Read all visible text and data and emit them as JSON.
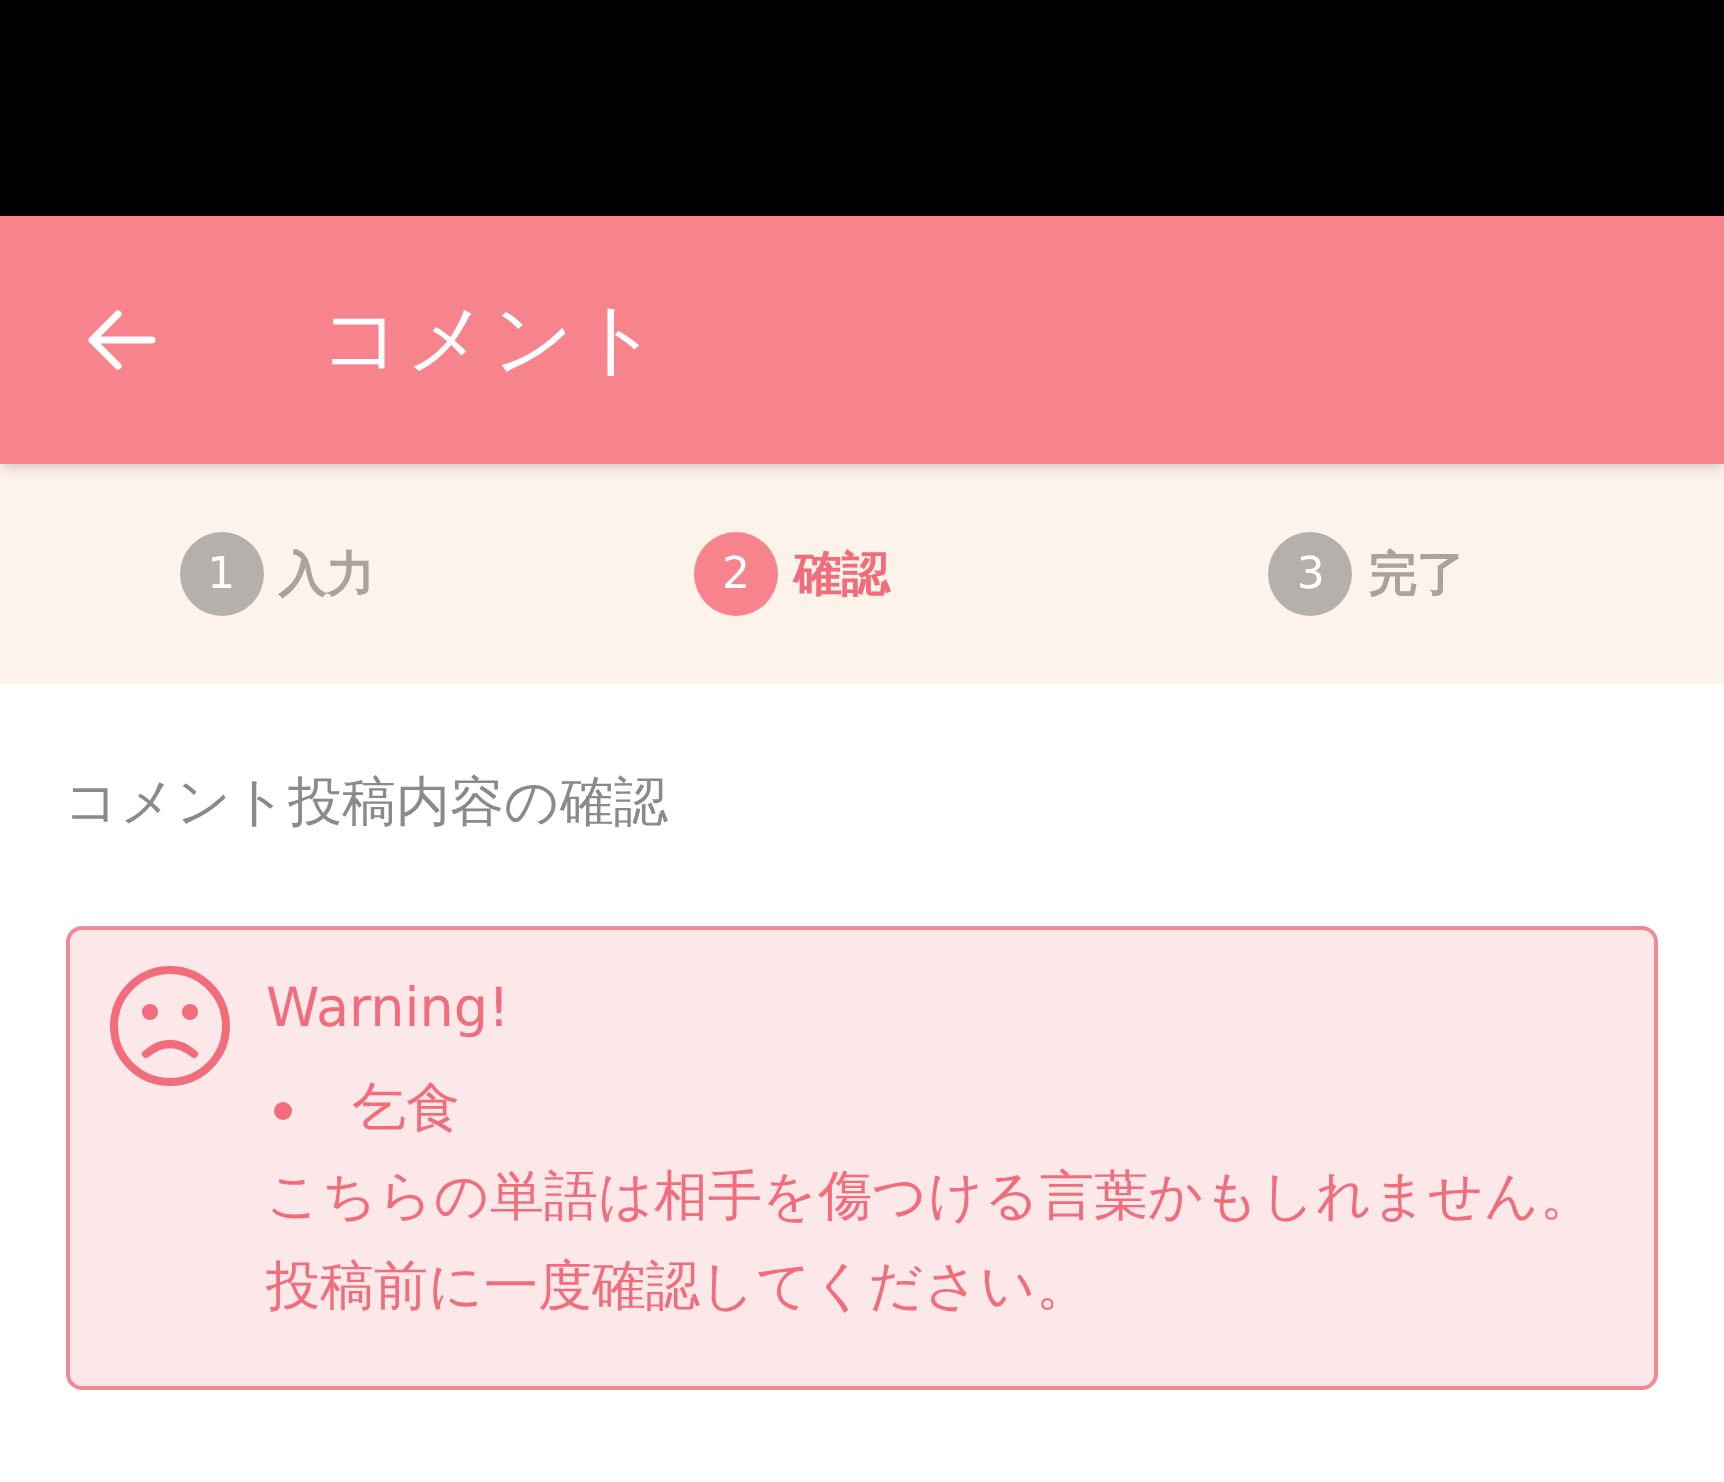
{
  "header": {
    "title": "コメント"
  },
  "steps": [
    {
      "number": "1",
      "label": "入力",
      "selected": false
    },
    {
      "number": "2",
      "label": "確認",
      "selected": true
    },
    {
      "number": "3",
      "label": "完了",
      "selected": false
    }
  ],
  "heading": "コメント投稿内容の確認",
  "warning": {
    "title": "Warning!",
    "words": [
      "乞食"
    ],
    "message": "こちらの単語は相手を傷つける言葉かもしれません。投稿前に一度確認してください。"
  }
}
